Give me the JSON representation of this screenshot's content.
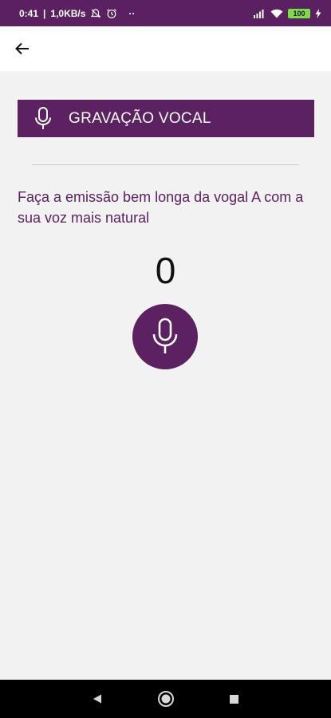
{
  "status_bar": {
    "time": "0:41",
    "separator": "|",
    "speed": "1,0KB/s",
    "dots": "··",
    "battery": "100",
    "icons": [
      "silent-mode-icon",
      "alarm-icon",
      "signal-icon",
      "wifi-icon",
      "battery-icon",
      "charging-icon"
    ]
  },
  "app_bar": {
    "back_icon": "arrow-left-icon"
  },
  "header": {
    "icon": "microphone-icon",
    "title": "GRAVAÇÃO VOCAL"
  },
  "instruction": "Faça a emissão bem longa da vogal A com a sua voz mais natural",
  "counter": "0",
  "record_button": {
    "icon": "microphone-icon"
  },
  "nav_bar": {
    "icons": [
      "back-triangle-icon",
      "home-circle-icon",
      "recents-square-icon"
    ]
  },
  "colors": {
    "brand": "#5c2160",
    "status_bar": "#5a2060",
    "background": "#f2f2f2",
    "text_accent": "#5c2160"
  }
}
